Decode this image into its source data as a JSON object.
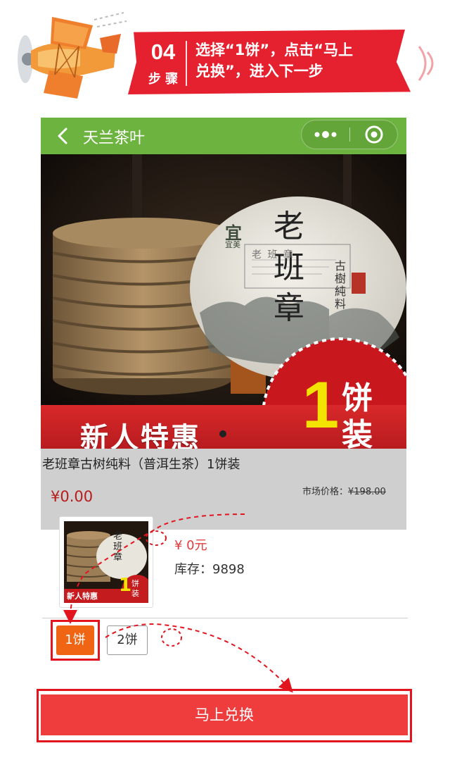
{
  "tutorial": {
    "step_number": "04",
    "step_word": "步 骤",
    "instruction_line1": "选择“1饼”，点击“马上",
    "instruction_line2": "兑换”，进入下一步"
  },
  "navbar": {
    "title": "天兰茶叶",
    "more_glyph": "•••"
  },
  "product_image": {
    "seal_big_chars": "老班章",
    "seal_small_text": "古樹純料",
    "seal_header": "老 班 章",
    "brand_mark": "宜",
    "brand_name": "宜美",
    "promo_text": "新人特惠",
    "badge_number": "1",
    "badge_char1": "饼",
    "badge_char2": "装"
  },
  "product": {
    "title": "老班章古树纯料（普洱生茶）1饼装",
    "price": "¥0.00",
    "market_price_label": "市场价格：",
    "market_price_value": "¥198.00"
  },
  "spec_panel": {
    "thumb_promo": "新人特惠",
    "thumb_num": "1",
    "thumb_c1": "饼",
    "thumb_c2": "装",
    "thumb_seal": "老班章",
    "price": "¥ 0元",
    "stock": "库存：9898",
    "options": [
      {
        "label": "1饼",
        "selected": true
      },
      {
        "label": "2饼",
        "selected": false
      }
    ]
  },
  "redeem_button": {
    "label": "马上兑换"
  },
  "colors": {
    "navbar_green": "#6db33f",
    "accent_red": "#e2151f",
    "selected_orange": "#f06513",
    "button_red": "#ef3c3c"
  }
}
